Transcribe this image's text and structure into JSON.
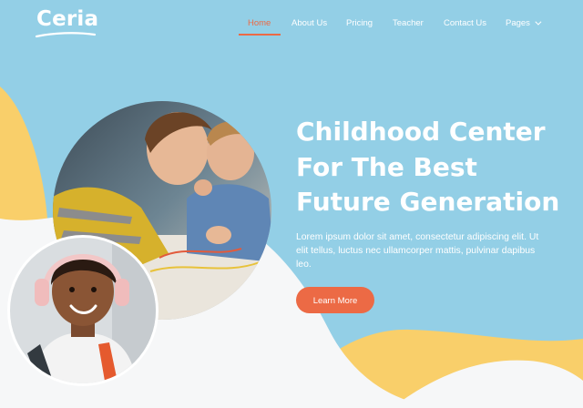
{
  "brand": {
    "name": "Ceria"
  },
  "nav": {
    "items": [
      {
        "label": "Home",
        "active": true
      },
      {
        "label": "About Us",
        "active": false
      },
      {
        "label": "Pricing",
        "active": false
      },
      {
        "label": "Teacher",
        "active": false
      },
      {
        "label": "Contact Us",
        "active": false
      },
      {
        "label": "Pages",
        "active": false,
        "dropdown": true
      }
    ]
  },
  "hero": {
    "title_lines": [
      "Childhood Center",
      "For The Best",
      "Future Generation"
    ],
    "text": "Lorem ipsum dolor sit amet, consectetur adipiscing elit. Ut elit tellus, luctus nec ullamcorper mattis, pulvinar dapibus leo.",
    "cta_label": "Learn More"
  },
  "colors": {
    "background": "#93cfe6",
    "accent": "#ec6a45",
    "wave_yellow": "#f9cf6a",
    "wave_white": "#f6f7f8",
    "text": "#ffffff"
  },
  "icons": {
    "dropdown": "chevron-down-icon"
  }
}
